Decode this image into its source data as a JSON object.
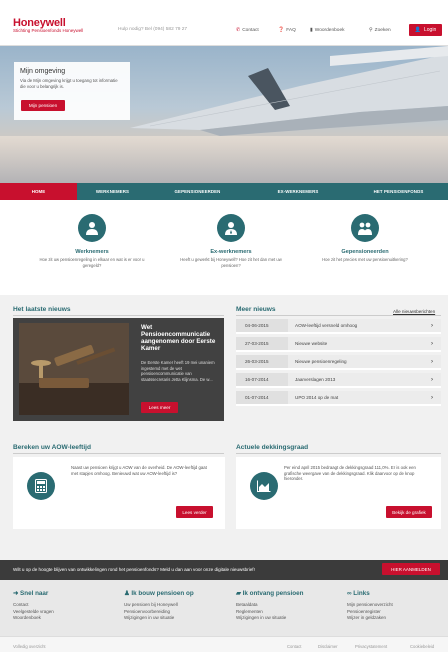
{
  "header": {
    "brand": "Honeywell",
    "brand_sub": "Stichting Pensioenfonds Honeywell",
    "help_text": "Hulp nodig? Bel (094) 582 79 27",
    "nav": [
      "Contact",
      "FAQ",
      "Woordenboek",
      "Zoeken"
    ],
    "login": "Login"
  },
  "hero": {
    "title": "Mijn omgeving",
    "text": "Via de Mijn omgeving krijgt u toegang tot informatie die voor u belangrijk is.",
    "button": "Mijn pensioen"
  },
  "mainnav": [
    "HOME",
    "WERKNEMERS",
    "GEPENSIONEERDEN",
    "EX-WERKNEMERS",
    "HET PENSIOENFONDS"
  ],
  "personas": [
    {
      "title": "Werknemers",
      "text": "Hoe zit uw pensioenregeling in elkaar en wat is er voor u geregeld?"
    },
    {
      "title": "Ex-werknemers",
      "text": "Heeft u gewerkt bij Honeywell? Hoe zit het dan met uw pensioen?"
    },
    {
      "title": "Gepensioneerden",
      "text": "Hoe zit het precies met uw pensioenuitkering?"
    }
  ],
  "latest_news": {
    "section_title": "Het laatste nieuws",
    "headline": "Wet Pensioencommunicatie aangenomen door Eerste Kamer",
    "body": "De Eerste Kamer heeft 19 mei unaniem ingestemd met de wet pensioencommunicatie van staatssecretaris Jetta Klijnsma. De w...",
    "button": "Lees meer"
  },
  "more_news": {
    "section_title": "Meer nieuws",
    "all_link": "Alle nieuwsberichten",
    "items": [
      {
        "date": "04-06-2015",
        "title": "AOW-leeftijd versneld omhoog"
      },
      {
        "date": "27-03-2015",
        "title": "Nieuwe website"
      },
      {
        "date": "26-03-2015",
        "title": "Nieuwe pensioenregeling"
      },
      {
        "date": "16-07-2014",
        "title": "Jaarverslagen 2013"
      },
      {
        "date": "01-07-2014",
        "title": "UPO 2014 op de mat"
      }
    ]
  },
  "aow": {
    "section_title": "Bereken uw AOW-leeftijd",
    "text": "Naast uw pensioen krijgt u AOW van de overheid. De AOW-leeftijd gaat met stapjes omhoog. Benieuwd wat uw AOW-leeftijd is?",
    "button": "Lees verder"
  },
  "dekking": {
    "section_title": "Actuele dekkingsgraad",
    "text": "Per eind april 2015 bedraagt de dekkingsgraad 111,0%. Er is ook een grafische weergave van de dekkingsgraad. Klik daarvoor op de knop hieronder.",
    "button": "Bekijk de grafiek"
  },
  "newsletter": {
    "text": "Wilt u op de hoogte blijven van ontwikkelingen rond het pensioenfonds? Meld u dan aan voor onze digitale nieuwsbrief!",
    "button": "HIER AANMELDEN"
  },
  "footer": {
    "cols": [
      {
        "title": "Snel naar",
        "links": [
          "Contact",
          "Veelgestelde vragen",
          "Woordenboek"
        ]
      },
      {
        "title": "Ik bouw pensioen op",
        "links": [
          "Uw pensioen bij Honeywell",
          "Pensioenvoorbereiding",
          "Wijzigingen in uw situatie"
        ]
      },
      {
        "title": "Ik ontvang pensioen",
        "links": [
          "Betaaldata",
          "Reglementen",
          "Wijzigingen in uw situatie"
        ]
      },
      {
        "title": "Links",
        "links": [
          "Mijn pensioenoverzicht",
          "Pensioenregister",
          "Wijzer in geldzaken"
        ]
      }
    ],
    "bottom_left": "Volledig overzicht",
    "bottom_links": [
      "Contact",
      "Disclaimer",
      "Privacystatement",
      "Cookiebeleid"
    ]
  },
  "colors": {
    "brand_red": "#c8102e",
    "teal": "#2a6b72"
  }
}
